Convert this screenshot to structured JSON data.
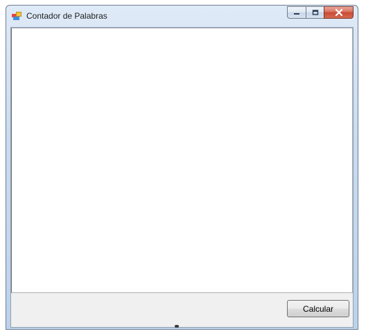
{
  "window": {
    "title": "Contador de Palabras",
    "icon": "windows-form-icon"
  },
  "caption_buttons": {
    "minimize": "minimize-icon",
    "maximize": "maximize-icon",
    "close": "close-icon"
  },
  "text_area": {
    "value": ""
  },
  "calculate_button": {
    "label": "Calcular"
  },
  "colors": {
    "frame": "#c9dcf0",
    "client": "#f0f0f0",
    "close_button": "#c74a33"
  }
}
